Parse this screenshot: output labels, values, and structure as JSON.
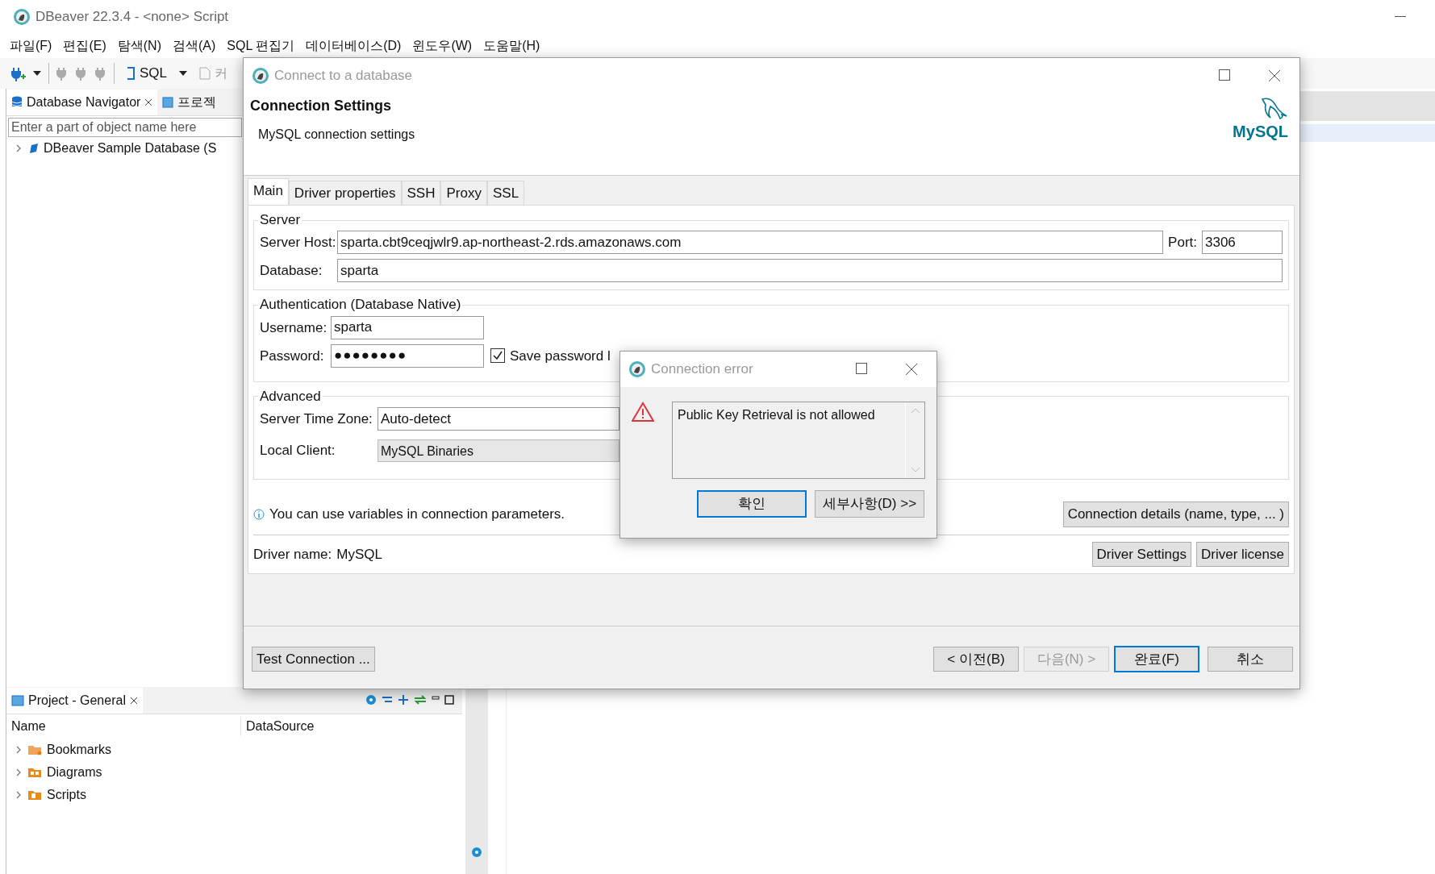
{
  "app": {
    "title": "DBeaver 22.3.4 - <none> Script",
    "menu": [
      "파일(F)",
      "편집(E)",
      "탐색(N)",
      "검색(A)",
      "SQL 편집기",
      "데이터베이스(D)",
      "윈도우(W)",
      "도움말(H)"
    ],
    "toolbar": {
      "sql_label": "SQL",
      "commit_label": "커"
    }
  },
  "navigator": {
    "tabs": [
      {
        "label": "Database Navigator",
        "selected": true
      },
      {
        "label": "프로젝",
        "selected": false
      }
    ],
    "search": {
      "placeholder": "Enter a part of object name here"
    },
    "tree": [
      {
        "label": "DBeaver Sample Database (S",
        "expanded": false
      }
    ]
  },
  "project": {
    "tab": "Project - General",
    "columns": [
      "Name",
      "DataSource"
    ],
    "rows": [
      {
        "label": "Bookmarks",
        "expanded": false
      },
      {
        "label": "Diagrams",
        "expanded": false
      },
      {
        "label": "Scripts",
        "expanded": false
      }
    ]
  },
  "connect_dialog": {
    "title": "Connect to a database",
    "heading": "Connection Settings",
    "subheading": "MySQL connection settings",
    "logo": "MySQL",
    "tabs": [
      {
        "label": "Main",
        "selected": true
      },
      {
        "label": "Driver properties",
        "selected": false
      },
      {
        "label": "SSH",
        "selected": false
      },
      {
        "label": "Proxy",
        "selected": false
      },
      {
        "label": "SSL",
        "selected": false
      }
    ],
    "server": {
      "legend": "Server",
      "host_label": "Server Host:",
      "host": "sparta.cbt9ceqjwlr9.ap-northeast-2.rds.amazonaws.com",
      "port_label": "Port:",
      "port": "3306",
      "database_label": "Database:",
      "database": "sparta"
    },
    "auth": {
      "legend": "Authentication (Database Native)",
      "username_label": "Username:",
      "username": "sparta",
      "password_label": "Password:",
      "password": "●●●●●●●●",
      "save_password": {
        "label": "Save password l",
        "checked": true
      }
    },
    "advanced": {
      "legend": "Advanced",
      "timezone_label": "Server Time Zone:",
      "timezone": "Auto-detect",
      "client_label": "Local Client:",
      "client": "MySQL Binaries"
    },
    "info": "You can use variables in connection parameters.",
    "details_button": "Connection details (name, type, ... )",
    "driver_label": "Driver name:",
    "driver": "MySQL",
    "driver_buttons": [
      "Driver Settings",
      "Driver license"
    ],
    "test_button": "Test Connection ...",
    "nav_buttons": [
      {
        "label": "< 이전(B)",
        "disabled": false,
        "default": false
      },
      {
        "label": "다음(N) >",
        "disabled": true,
        "default": false
      },
      {
        "label": "완료(F)",
        "disabled": false,
        "default": true
      },
      {
        "label": "취소",
        "disabled": false,
        "default": false
      }
    ]
  },
  "error_dialog": {
    "title": "Connection error",
    "message": "Public Key Retrieval is not allowed",
    "buttons": [
      {
        "label": "확인",
        "default": true
      },
      {
        "label": "세부사항(D) >>",
        "default": false
      }
    ]
  }
}
